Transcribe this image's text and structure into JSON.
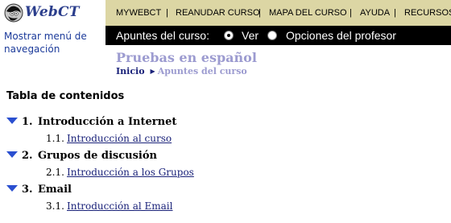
{
  "brand": {
    "logo_text": "WebCT"
  },
  "nav_toggle": "Mostrar menú de navegación",
  "top_menu": {
    "items": [
      "MYWEBCT",
      "REANUDAR CURSO",
      "MAPA DEL CURSO",
      "AYUDA",
      "RECURSOS"
    ],
    "separator": "|"
  },
  "mode_bar": {
    "label": "Apuntes del curso:",
    "options": [
      {
        "label": "Ver",
        "selected": true
      },
      {
        "label": "Opciones del profesor",
        "selected": false
      }
    ]
  },
  "page": {
    "title": "Pruebas en español",
    "breadcrumb": {
      "home": "Inicio",
      "current": "Apuntes del curso"
    }
  },
  "toc": {
    "heading": "Tabla de contenidos",
    "sections": [
      {
        "number": "1.",
        "title": "Introducción a Internet",
        "items": [
          {
            "number": "1.1.",
            "label": "Introducción al curso"
          }
        ]
      },
      {
        "number": "2.",
        "title": "Grupos de discusión",
        "items": [
          {
            "number": "2.1.",
            "label": "Introducción a los Grupos"
          }
        ]
      },
      {
        "number": "3.",
        "title": "Email",
        "items": [
          {
            "number": "3.1.",
            "label": "Introducción al Email"
          }
        ]
      }
    ]
  },
  "colors": {
    "menu_bar": "#dcd6a4",
    "mode_bar": "#000000",
    "title": "#9c9bd0",
    "link": "#1b237a",
    "nav_link": "#1b3a9a",
    "expand_triangle": "#2a4fd0"
  },
  "icons": [
    "webct-globe-logo",
    "radio-selected",
    "radio-unselected",
    "breadcrumb-arrow",
    "expand-triangle"
  ]
}
